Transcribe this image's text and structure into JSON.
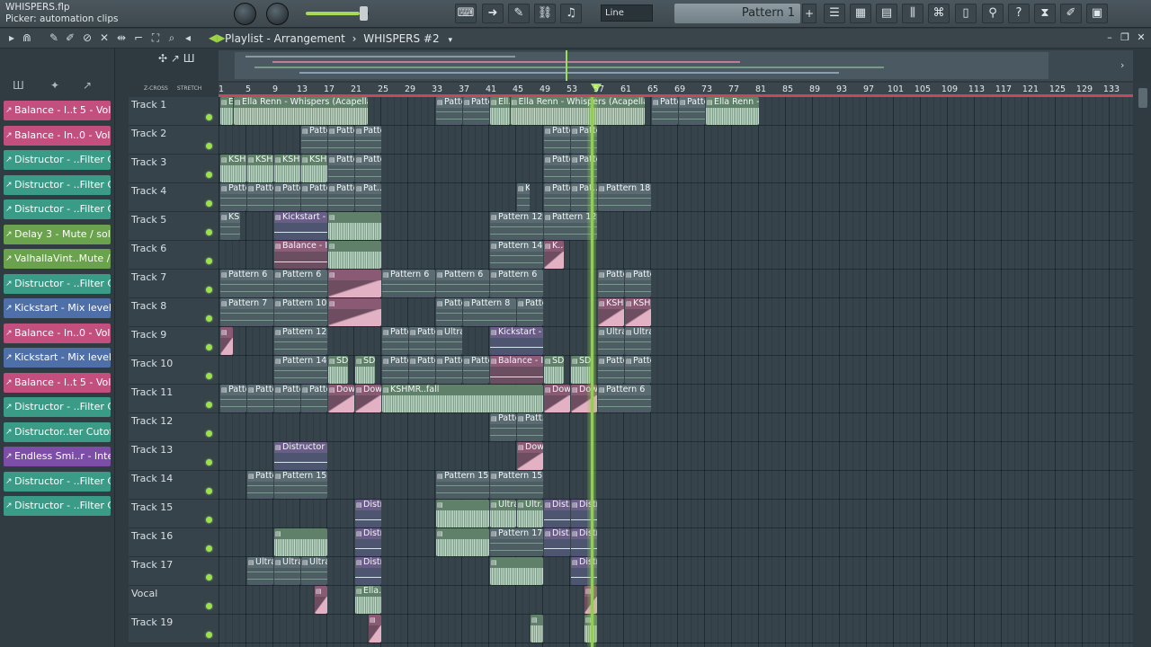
{
  "file": {
    "name": "WHISPERS.flp",
    "hint": "Picker: automation clips"
  },
  "toolbar": {
    "snap_mode": "Line",
    "pattern": "Pattern 1",
    "pattern_add": "+",
    "buttons": [
      "piano-icon",
      "arrow-right-icon",
      "pencil-icon",
      "link-icon",
      "metronome-icon"
    ],
    "right_buttons": [
      "playlist-icon",
      "piano-roll-icon",
      "channel-rack-icon",
      "mixer-icon",
      "plugin-icon",
      "browser-icon",
      "tuner-icon",
      "help-icon",
      "cpu-icon",
      "record-icon",
      "save-icon"
    ]
  },
  "playlist": {
    "title_prefix": "Playlist - Arrangement",
    "separator": "›",
    "arrangement": "WHISPERS #2",
    "arrangement_arrow": "▾",
    "zoom_label": "Z-CROSS",
    "stretch_label": "STRETCH"
  },
  "ruler": [
    "1",
    "5",
    "9",
    "13",
    "17",
    "21",
    "25",
    "29",
    "33",
    "37",
    "41",
    "45",
    "49",
    "53",
    "57",
    "61",
    "65",
    "69",
    "73",
    "77",
    "81",
    "85",
    "89",
    "93",
    "97",
    "101",
    "105",
    "109",
    "113",
    "117",
    "121",
    "125",
    "129",
    "133"
  ],
  "clip_sources": [
    {
      "label": "Balance - I..t 5 - Volume",
      "color": "pink"
    },
    {
      "label": "Balance - In..0 - Volume",
      "color": "pink"
    },
    {
      "label": "Distructor - ..Filter Cutoff",
      "color": "teal"
    },
    {
      "label": "Distructor - ..Filter Cutoff",
      "color": "teal"
    },
    {
      "label": "Distructor - ..Filter Cutoff",
      "color": "teal"
    },
    {
      "label": "Delay 3 - Mute / solo",
      "color": "green"
    },
    {
      "label": "ValhallaVint..Mute / solo",
      "color": "green"
    },
    {
      "label": "Distructor - ..Filter Cutoff",
      "color": "teal"
    },
    {
      "label": "Kickstart - Mix level",
      "color": "blue"
    },
    {
      "label": "Balance - In..0 - Volume",
      "color": "pink"
    },
    {
      "label": "Kickstart - Mix level",
      "color": "blue"
    },
    {
      "label": "Balance - I..t 5 - Volume",
      "color": "pink"
    },
    {
      "label": "Distructor - ..Filter Cutoff",
      "color": "teal"
    },
    {
      "label": "Distructor..ter Cutoff #2",
      "color": "teal"
    },
    {
      "label": "Endless Smi..r - Intensit",
      "color": "purple"
    },
    {
      "label": "Distructor - ..Filter Cutoff",
      "color": "teal"
    },
    {
      "label": "Distructor - ..Filter Cutoff",
      "color": "teal"
    }
  ],
  "tracks": [
    "Track 1",
    "Track 2",
    "Track 3",
    "Track 4",
    "Track 5",
    "Track 6",
    "Track 7",
    "Track 8",
    "Track 9",
    "Track 10",
    "Track 11",
    "Track 12",
    "Track 13",
    "Track 14",
    "Track 15",
    "Track 16",
    "Track 17",
    "Vocal",
    "Track 19"
  ],
  "clips": [
    {
      "t": 0,
      "bar": 1,
      "len": 2,
      "k": "aud",
      "label": "El..ella)"
    },
    {
      "t": 0,
      "bar": 3,
      "len": 20,
      "k": "aud",
      "label": "Ella Renn - Whispers (Acapella)"
    },
    {
      "t": 0,
      "bar": 33,
      "len": 4,
      "k": "pat",
      "label": "Pattern 1"
    },
    {
      "t": 0,
      "bar": 37,
      "len": 4,
      "k": "pat",
      "label": "Pattern 1"
    },
    {
      "t": 0,
      "bar": 41,
      "len": 3,
      "k": "aud",
      "label": "Ell..ella)"
    },
    {
      "t": 0,
      "bar": 44,
      "len": 20,
      "k": "aud",
      "label": "Ella Renn - Whispers (Acapella)"
    },
    {
      "t": 0,
      "bar": 65,
      "len": 4,
      "k": "pat",
      "label": "Pattern 1"
    },
    {
      "t": 0,
      "bar": 69,
      "len": 4,
      "k": "pat",
      "label": "Pattern 1"
    },
    {
      "t": 0,
      "bar": 73,
      "len": 8,
      "k": "aud",
      "label": "Ella Renn - W..rs (Acapella)"
    },
    {
      "t": 1,
      "bar": 13,
      "len": 4,
      "k": "pat",
      "label": "Pattern 11"
    },
    {
      "t": 1,
      "bar": 17,
      "len": 4,
      "k": "pat",
      "label": "Pattern 2"
    },
    {
      "t": 1,
      "bar": 21,
      "len": 4,
      "k": "pat",
      "label": "Pattern 2"
    },
    {
      "t": 1,
      "bar": 49,
      "len": 4,
      "k": "pat",
      "label": "Pattern 2"
    },
    {
      "t": 1,
      "bar": 53,
      "len": 4,
      "k": "pat",
      "label": "Pattern 2"
    },
    {
      "t": 2,
      "bar": 1,
      "len": 4,
      "k": "aud",
      "label": "KSHMR..fall"
    },
    {
      "t": 2,
      "bar": 5,
      "len": 4,
      "k": "aud",
      "label": "KSHMR..fall"
    },
    {
      "t": 2,
      "bar": 9,
      "len": 4,
      "k": "aud",
      "label": "KSHMR..fall"
    },
    {
      "t": 2,
      "bar": 13,
      "len": 4,
      "k": "aud",
      "label": "KSHM..fall"
    },
    {
      "t": 2,
      "bar": 17,
      "len": 4,
      "k": "pat",
      "label": "Pattern 3"
    },
    {
      "t": 2,
      "bar": 21,
      "len": 4,
      "k": "pat",
      "label": "Pattern 3"
    },
    {
      "t": 2,
      "bar": 49,
      "len": 4,
      "k": "pat",
      "label": "Pattern 3"
    },
    {
      "t": 2,
      "bar": 53,
      "len": 4,
      "k": "pat",
      "label": "Pattern 3"
    },
    {
      "t": 3,
      "bar": 1,
      "len": 4,
      "k": "pat",
      "label": "Pattern 11"
    },
    {
      "t": 3,
      "bar": 5,
      "len": 4,
      "k": "pat",
      "label": "Pattern 11"
    },
    {
      "t": 3,
      "bar": 9,
      "len": 4,
      "k": "pat",
      "label": "Pattern 11"
    },
    {
      "t": 3,
      "bar": 13,
      "len": 4,
      "k": "pat",
      "label": "Pattern 1"
    },
    {
      "t": 3,
      "bar": 17,
      "len": 4,
      "k": "pat",
      "label": "Pattern 4"
    },
    {
      "t": 3,
      "bar": 21,
      "len": 4,
      "k": "pat",
      "label": "Pat..n 4"
    },
    {
      "t": 3,
      "bar": 45,
      "len": 2,
      "k": "pat",
      "label": "K..6"
    },
    {
      "t": 3,
      "bar": 49,
      "len": 4,
      "k": "pat",
      "label": "Pattern 4"
    },
    {
      "t": 3,
      "bar": 53,
      "len": 4,
      "k": "pat",
      "label": "Pat..n 4"
    },
    {
      "t": 3,
      "bar": 57,
      "len": 8,
      "k": "pat",
      "label": "Pattern 18"
    },
    {
      "t": 4,
      "bar": 1,
      "len": 3,
      "k": "pat",
      "label": "KS..08"
    },
    {
      "t": 4,
      "bar": 9,
      "len": 8,
      "k": "auto",
      "label": "Kickstart - Mix level"
    },
    {
      "t": 4,
      "bar": 17,
      "len": 8,
      "k": "aud",
      "label": ""
    },
    {
      "t": 4,
      "bar": 41,
      "len": 8,
      "k": "pat",
      "label": "Pattern 12"
    },
    {
      "t": 4,
      "bar": 49,
      "len": 8,
      "k": "pat",
      "label": "Pattern 12"
    },
    {
      "t": 5,
      "bar": 9,
      "len": 8,
      "k": "autop",
      "label": "Balance - In..t 5 - Volume"
    },
    {
      "t": 5,
      "bar": 17,
      "len": 8,
      "k": "aud",
      "label": ""
    },
    {
      "t": 5,
      "bar": 41,
      "len": 8,
      "k": "pat",
      "label": "Pattern 14"
    },
    {
      "t": 5,
      "bar": 49,
      "len": 3,
      "k": "pink",
      "label": "K..an"
    },
    {
      "t": 6,
      "bar": 1,
      "len": 8,
      "k": "pat",
      "label": "Pattern 6"
    },
    {
      "t": 6,
      "bar": 9,
      "len": 8,
      "k": "pat",
      "label": "Pattern 6"
    },
    {
      "t": 6,
      "bar": 17,
      "len": 8,
      "k": "pink",
      "label": ""
    },
    {
      "t": 6,
      "bar": 25,
      "len": 8,
      "k": "pat",
      "label": "Pattern 6"
    },
    {
      "t": 6,
      "bar": 33,
      "len": 8,
      "k": "pat",
      "label": "Pattern 6"
    },
    {
      "t": 6,
      "bar": 41,
      "len": 8,
      "k": "pat",
      "label": "Pattern 6"
    },
    {
      "t": 6,
      "bar": 57,
      "len": 4,
      "k": "pat",
      "label": "Pattern 13"
    },
    {
      "t": 6,
      "bar": 61,
      "len": 4,
      "k": "pat",
      "label": "Pattern 1"
    },
    {
      "t": 7,
      "bar": 1,
      "len": 8,
      "k": "pat",
      "label": "Pattern 7"
    },
    {
      "t": 7,
      "bar": 9,
      "len": 8,
      "k": "pat",
      "label": "Pattern 10"
    },
    {
      "t": 7,
      "bar": 17,
      "len": 8,
      "k": "pink",
      "label": ""
    },
    {
      "t": 7,
      "bar": 33,
      "len": 4,
      "k": "pat",
      "label": "Pattern 9"
    },
    {
      "t": 7,
      "bar": 37,
      "len": 8,
      "k": "pat",
      "label": "Pattern 8"
    },
    {
      "t": 7,
      "bar": 45,
      "len": 4,
      "k": "pat",
      "label": "Pattern 1"
    },
    {
      "t": 7,
      "bar": 57,
      "len": 4,
      "k": "pink",
      "label": "KSHMR..fall"
    },
    {
      "t": 7,
      "bar": 61,
      "len": 4,
      "k": "pink",
      "label": "KSHMR..fall"
    },
    {
      "t": 8,
      "bar": 1,
      "len": 2,
      "k": "pink",
      "label": ""
    },
    {
      "t": 8,
      "bar": 9,
      "len": 8,
      "k": "pat",
      "label": "Pattern 12"
    },
    {
      "t": 8,
      "bar": 25,
      "len": 4,
      "k": "pat",
      "label": "Pattern 11"
    },
    {
      "t": 8,
      "bar": 29,
      "len": 4,
      "k": "pat",
      "label": "Pattern 11"
    },
    {
      "t": 8,
      "bar": 33,
      "len": 4,
      "k": "pat",
      "label": "Ultra.. - C"
    },
    {
      "t": 8,
      "bar": 41,
      "len": 8,
      "k": "auto",
      "label": "Kickstart - Mix level"
    },
    {
      "t": 8,
      "bar": 57,
      "len": 4,
      "k": "pat",
      "label": "Ultra..1 - C"
    },
    {
      "t": 8,
      "bar": 61,
      "len": 4,
      "k": "pat",
      "label": "Ultra.. - C"
    },
    {
      "t": 9,
      "bar": 9,
      "len": 8,
      "k": "pat",
      "label": "Pattern 14"
    },
    {
      "t": 9,
      "bar": 17,
      "len": 3,
      "k": "aud",
      "label": "SD..)"
    },
    {
      "t": 9,
      "bar": 21,
      "len": 3,
      "k": "aud",
      "label": "SD..)"
    },
    {
      "t": 9,
      "bar": 25,
      "len": 4,
      "k": "pat",
      "label": "Pattern 13"
    },
    {
      "t": 9,
      "bar": 29,
      "len": 4,
      "k": "pat",
      "label": "Pattern 13"
    },
    {
      "t": 9,
      "bar": 33,
      "len": 4,
      "k": "pat",
      "label": "Pattern 13"
    },
    {
      "t": 9,
      "bar": 37,
      "len": 4,
      "k": "pat",
      "label": "Pattern 13"
    },
    {
      "t": 9,
      "bar": 41,
      "len": 8,
      "k": "autop",
      "label": "Balance - In..rt 5 - Volume"
    },
    {
      "t": 9,
      "bar": 49,
      "len": 3,
      "k": "aud",
      "label": "SD..)"
    },
    {
      "t": 9,
      "bar": 53,
      "len": 3,
      "k": "aud",
      "label": "SD..)"
    },
    {
      "t": 9,
      "bar": 57,
      "len": 4,
      "k": "pat",
      "label": "Pattern 11"
    },
    {
      "t": 9,
      "bar": 61,
      "len": 4,
      "k": "pat",
      "label": "Pattern 11"
    },
    {
      "t": 10,
      "bar": 1,
      "len": 4,
      "k": "pat",
      "label": "Pattern 13"
    },
    {
      "t": 10,
      "bar": 5,
      "len": 4,
      "k": "pat",
      "label": "Pattern 13"
    },
    {
      "t": 10,
      "bar": 9,
      "len": 4,
      "k": "pat",
      "label": "Pattern 13"
    },
    {
      "t": 10,
      "bar": 13,
      "len": 4,
      "k": "pat",
      "label": "Pattern 13"
    },
    {
      "t": 10,
      "bar": 17,
      "len": 4,
      "k": "pink",
      "label": "Dow..01"
    },
    {
      "t": 10,
      "bar": 21,
      "len": 4,
      "k": "pink",
      "label": "Dow..01"
    },
    {
      "t": 10,
      "bar": 25,
      "len": 24,
      "k": "aud",
      "label": "KSHMR..fall"
    },
    {
      "t": 10,
      "bar": 49,
      "len": 4,
      "k": "pink",
      "label": "Dow..01"
    },
    {
      "t": 10,
      "bar": 53,
      "len": 4,
      "k": "pink",
      "label": "Dow..01"
    },
    {
      "t": 10,
      "bar": 57,
      "len": 8,
      "k": "pat",
      "label": "Pattern 6"
    },
    {
      "t": 11,
      "bar": 41,
      "len": 4,
      "k": "pat",
      "label": "Pattern 16"
    },
    {
      "t": 11,
      "bar": 45,
      "len": 4,
      "k": "pat",
      "label": "Patt..16"
    },
    {
      "t": 12,
      "bar": 9,
      "len": 8,
      "k": "auto",
      "label": "Distructor - ..: Filter Cutoff"
    },
    {
      "t": 12,
      "bar": 45,
      "len": 4,
      "k": "pink",
      "label": "Down..#2"
    },
    {
      "t": 13,
      "bar": 5,
      "len": 4,
      "k": "pat",
      "label": "Pattern 15"
    },
    {
      "t": 13,
      "bar": 9,
      "len": 8,
      "k": "pat",
      "label": "Pattern 15"
    },
    {
      "t": 13,
      "bar": 33,
      "len": 8,
      "k": "pat",
      "label": "Pattern 15"
    },
    {
      "t": 13,
      "bar": 41,
      "len": 8,
      "k": "pat",
      "label": "Pattern 15"
    },
    {
      "t": 14,
      "bar": 21,
      "len": 4,
      "k": "auto",
      "label": "Distru..Cutoff"
    },
    {
      "t": 14,
      "bar": 33,
      "len": 8,
      "k": "aud",
      "label": ""
    },
    {
      "t": 14,
      "bar": 41,
      "len": 4,
      "k": "aud",
      "label": "Ultra..1 - C"
    },
    {
      "t": 14,
      "bar": 45,
      "len": 4,
      "k": "aud",
      "label": "Ultr.. - C"
    },
    {
      "t": 14,
      "bar": 49,
      "len": 4,
      "k": "auto",
      "label": "Dist..toff"
    },
    {
      "t": 14,
      "bar": 53,
      "len": 4,
      "k": "auto",
      "label": "Distru..Cutoff"
    },
    {
      "t": 15,
      "bar": 9,
      "len": 8,
      "k": "aud",
      "label": ""
    },
    {
      "t": 15,
      "bar": 21,
      "len": 4,
      "k": "auto",
      "label": "Distr..r Cutoff"
    },
    {
      "t": 15,
      "bar": 33,
      "len": 8,
      "k": "aud",
      "label": ""
    },
    {
      "t": 15,
      "bar": 41,
      "len": 8,
      "k": "pat",
      "label": "Pattern 17"
    },
    {
      "t": 15,
      "bar": 49,
      "len": 4,
      "k": "auto",
      "label": "Dist..toff"
    },
    {
      "t": 15,
      "bar": 53,
      "len": 4,
      "k": "auto",
      "label": "Distr..r Cutoff"
    },
    {
      "t": 16,
      "bar": 5,
      "len": 4,
      "k": "pat",
      "label": "Ultra.. - C"
    },
    {
      "t": 16,
      "bar": 9,
      "len": 4,
      "k": "pat",
      "label": "Ultra.. - C"
    },
    {
      "t": 16,
      "bar": 13,
      "len": 4,
      "k": "pat",
      "label": "Ultra.. - C"
    },
    {
      "t": 16,
      "bar": 21,
      "len": 4,
      "k": "auto",
      "label": "Distru..Cutoff"
    },
    {
      "t": 16,
      "bar": 41,
      "len": 8,
      "k": "aud",
      "label": ""
    },
    {
      "t": 16,
      "bar": 53,
      "len": 4,
      "k": "auto",
      "label": "Distru..Cutoff"
    },
    {
      "t": 17,
      "bar": 15,
      "len": 2,
      "k": "pink",
      "label": ""
    },
    {
      "t": 17,
      "bar": 21,
      "len": 4,
      "k": "aud",
      "label": "Ella..la) #2"
    },
    {
      "t": 17,
      "bar": 55,
      "len": 2,
      "k": "pink",
      "label": ""
    },
    {
      "t": 18,
      "bar": 23,
      "len": 2,
      "k": "pink",
      "label": ""
    },
    {
      "t": 18,
      "bar": 47,
      "len": 2,
      "k": "aud",
      "label": ""
    },
    {
      "t": 18,
      "bar": 55,
      "len": 2,
      "k": "aud",
      "label": ""
    }
  ]
}
